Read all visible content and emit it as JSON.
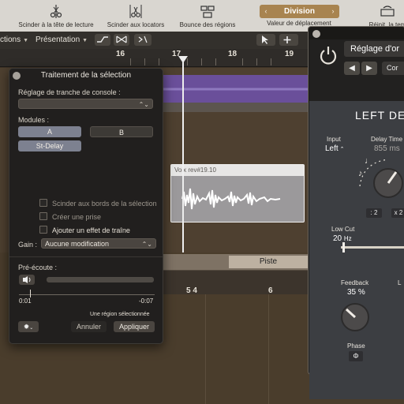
{
  "toolbar": {
    "items": [
      {
        "label": "Scinder à la tête de lecture",
        "icon": "scissors-playhead-icon"
      },
      {
        "label": "Scinder aux locators",
        "icon": "scissors-locators-icon"
      },
      {
        "label": "Bounce des régions",
        "icon": "bounce-regions-icon"
      },
      {
        "label": "Valeur de déplacement",
        "icon": "nudge-value-icon"
      },
      {
        "label": "Réinit. la tem",
        "icon": "reset-icon"
      }
    ],
    "division": {
      "value": "Division",
      "prev": "‹",
      "next": "›"
    }
  },
  "menubar": {
    "items": [
      "ctions",
      "Présentation"
    ],
    "tools": [
      "pointer-tool",
      "plus-tool",
      "ruler-tool"
    ]
  },
  "ruler": {
    "marks": [
      "16",
      "17",
      "18",
      "19"
    ]
  },
  "tracks": {
    "audio_region_title": "Voix rev#19.10"
  },
  "selection_panel": {
    "title": "Traitement de la sélection",
    "console_slice_label": "Réglage de tranche de console :",
    "console_slice_value": "",
    "modules_label": "Modules :",
    "module_a": "A",
    "module_b": "B",
    "module_effect": "St-Delay",
    "options": [
      {
        "label": "Scinder aux bords de la sélection",
        "checked": false,
        "active": false
      },
      {
        "label": "Créer une prise",
        "checked": false,
        "active": false
      },
      {
        "label": "Ajouter un effet de traîne",
        "checked": false,
        "active": true
      }
    ],
    "gain_label": "Gain :",
    "gain_value": "Aucune modification",
    "preview_label": "Pré-écoute :",
    "time_start": "0:01",
    "time_end": "-0:07",
    "status": "Une région sélectionnée",
    "cancel_label": "Annuler",
    "apply_label": "Appliquer"
  },
  "lower_editor": {
    "tab": "Piste",
    "marks": [
      "5 4",
      "6"
    ]
  },
  "plugin": {
    "preset": "Réglage d'or",
    "compare": "Cor",
    "title": "LEFT DEL",
    "input_label": "Input",
    "input_value": "Left",
    "delay_time_label": "Delay Time",
    "delay_time_value": "855 ms",
    "div_a": ": 2",
    "div_b": "x 2",
    "low_cut_label": "Low Cut",
    "low_cut_value": "20",
    "low_cut_unit": "Hz",
    "feedback_label": "Feedback",
    "feedback_value": "35 %",
    "phase_label": "Phase",
    "phase_value": "Φ",
    "cut_off_label": "L"
  },
  "colors": {
    "purple_region": "#6a4f9a",
    "accent_gold": "#a88450",
    "panel_bg": "#211f1e"
  }
}
